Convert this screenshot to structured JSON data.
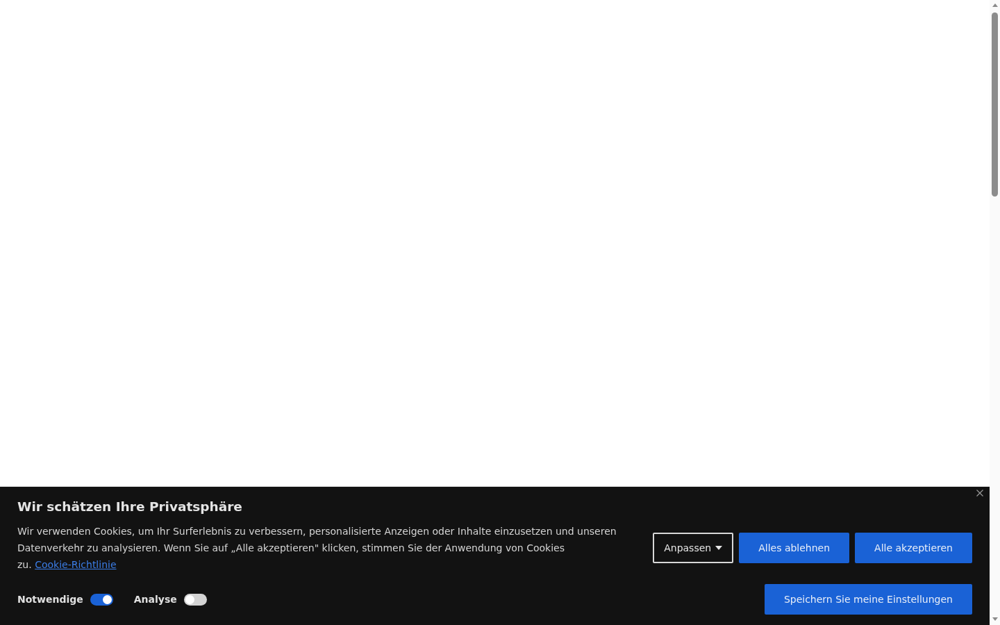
{
  "cookie_banner": {
    "title": "Wir schätzen Ihre Privatsphäre",
    "text": "Wir verwenden Cookies, um Ihr Surferlebnis zu verbessern, personalisierte Anzeigen oder Inhalte einzusetzen und unseren Datenverkehr zu analysieren. Wenn Sie auf „Alle akzeptieren\" klicken, stimmen Sie der Anwendung von Cookies zu.",
    "link": "Cookie-Richtlinie",
    "buttons": [
      {
        "label": "Anpassen",
        "kind": "dropdown"
      },
      {
        "label": "Alles ablehnen",
        "kind": "primary"
      },
      {
        "label": "Alle akzeptieren",
        "kind": "primary"
      }
    ],
    "toggles": [
      {
        "label": "Notwendige",
        "on": true
      },
      {
        "label": "Analyse",
        "on": false
      }
    ],
    "save_button": "Speichern Sie meine Einstellungen"
  }
}
